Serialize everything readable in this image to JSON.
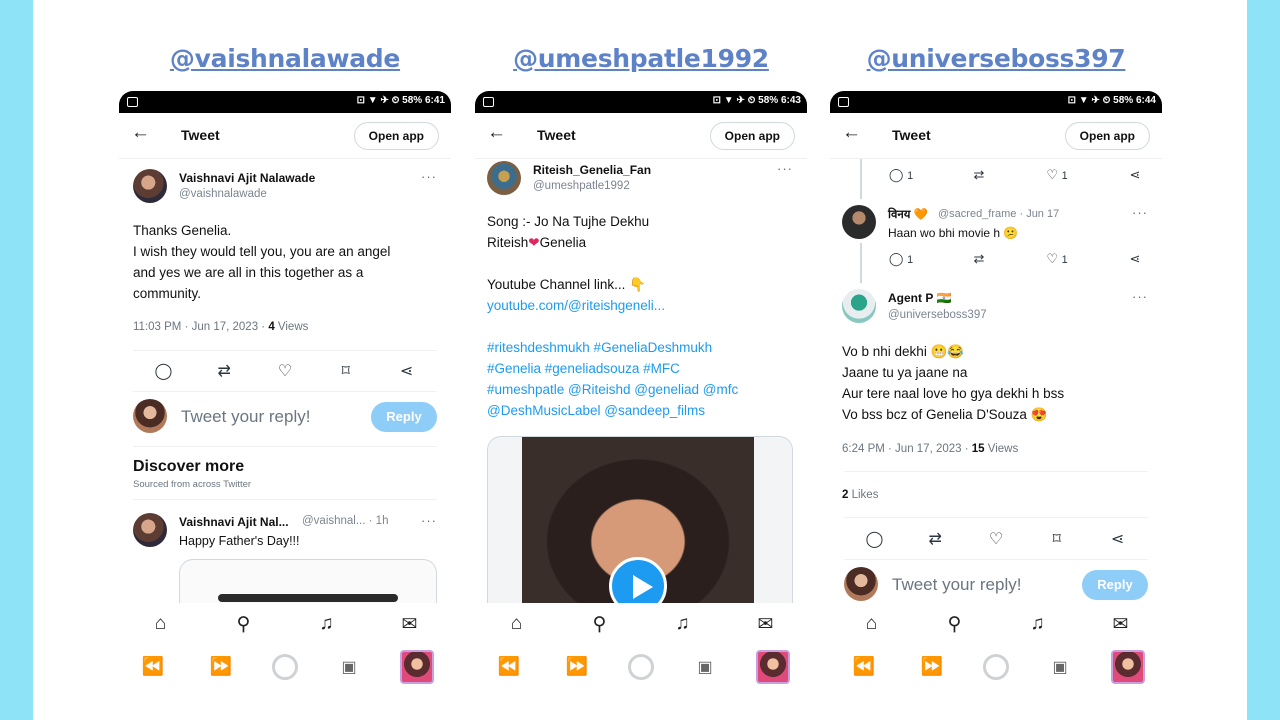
{
  "panels": [
    {
      "label": "@vaishnalawade",
      "status_right": "⊡ ▼ ✈ ⏲ 58% 6:41",
      "topbar": {
        "title": "Tweet",
        "open_app": "Open app"
      },
      "tweet": {
        "name": "Vaishnavi Ajit Nalawade",
        "handle": "@vaishnalawade",
        "lines": [
          "Thanks Genelia.",
          "I wish they would tell you, you are an angel",
          "and yes we are all in this together as a",
          "community."
        ],
        "timestamp": "11:03 PM · Jun 17, 2023 · ",
        "views_count": "4",
        "views_label": " Views"
      },
      "reply_placeholder": "Tweet your reply!",
      "reply_button": "Reply",
      "discover": {
        "title": "Discover more",
        "subtitle": "Sourced from across Twitter",
        "item_name": "Vaishnavi Ajit Nal...",
        "item_handle": "@vaishnal... · 1h",
        "item_text": "Happy Father's Day!!!"
      }
    },
    {
      "label": "@umeshpatle1992",
      "status_right": "⊡ ▼ ✈ ⏲ 58% 6:43",
      "topbar": {
        "title": "Tweet",
        "open_app": "Open app"
      },
      "tweet": {
        "name": "Riteish_Genelia_Fan",
        "handle": "@umeshpatle1992",
        "line1": "Song :- Jo Na Tujhe Dekhu",
        "line2a": "Riteish",
        "line2b": "Genelia",
        "line3": "Youtube Channel link... 👇",
        "link": "youtube.com/@riteishgeneli...",
        "tags": [
          "#riteshdeshmukh #GeneliaDeshmukh",
          "#Genelia #geneliadsouza #MFC",
          "#umeshpatle @Riteishd @geneliad @mfc",
          "@DeshMusicLabel @sandeep_films"
        ]
      }
    },
    {
      "label": "@universeboss397",
      "status_right": "⊡ ▼ ✈ ⏲ 58% 6:44",
      "topbar": {
        "title": "Tweet",
        "open_app": "Open app"
      },
      "stats": {
        "replies": "1",
        "likes": "1"
      },
      "reply_comment": {
        "name": "विनय 🧡",
        "handle": "@sacred_frame · Jun 17",
        "text": "Haan wo bhi movie h 😕"
      },
      "tweet": {
        "name": "Agent P 🇮🇳",
        "handle": "@universeboss397",
        "lines": [
          "Vo b nhi dekhi 😬😂",
          "Jaane tu ya jaane na",
          "Aur tere naal love ho gya dekhi h bss",
          "Vo bss bcz of Genelia D'Souza 😍"
        ],
        "timestamp": "6:24 PM · Jun 17, 2023 · ",
        "views_count": "15",
        "views_label": " Views",
        "likes_count": "2",
        "likes_label": " Likes"
      },
      "reply_placeholder": "Tweet your reply!",
      "reply_button": "Reply"
    }
  ],
  "icons": {
    "back": "←",
    "more": "···",
    "reply": "◯",
    "retweet": "⇄",
    "like": "♡",
    "bookmark": "⌑",
    "share": "⋖",
    "home": "⌂",
    "search": "⚲",
    "bell": "♫",
    "mail": "✉",
    "rewind": "⏪",
    "forward": "⏩",
    "tabs": "▣"
  },
  "colors": {
    "accent": "#1d9bf0",
    "reply_button": "#8ecdf8",
    "label": "#5e82c8",
    "frame": "#8fe3f7"
  }
}
